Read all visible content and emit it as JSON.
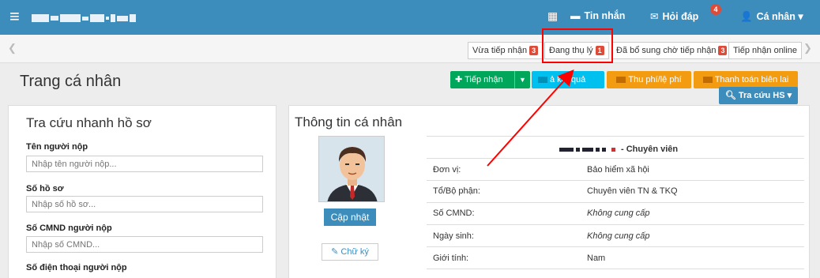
{
  "topbar": {
    "menu_icon": "hamburger-icon",
    "grid_icon": "grid-icon",
    "messages_label": "Tin nhắn",
    "qa_label": "Hỏi đáp",
    "qa_badge": "4",
    "personal_label": "Cá nhân",
    "personal_caret": "▾"
  },
  "tabs": [
    {
      "label": "Vừa tiếp nhận",
      "count": "3"
    },
    {
      "label": "Đang thụ lý",
      "count": "1"
    },
    {
      "label": "Đã bổ sung chờ tiếp nhận",
      "count": "3"
    },
    {
      "label": "Tiếp nhận online",
      "count": ""
    }
  ],
  "page": {
    "title": "Trang cá nhân"
  },
  "toolbar": {
    "receive_label": "Tiếp nhận",
    "result_label": "ả kết quả",
    "fee_label": "Thu phí/lệ phí",
    "payment_label": "Thanh toán biên lai",
    "search_label": "Tra cứu HS"
  },
  "search_panel": {
    "title": "Tra cứu nhanh hồ sơ",
    "fields": [
      {
        "label": "Tên người nộp",
        "placeholder": "Nhập tên người nộp..."
      },
      {
        "label": "Số hồ sơ",
        "placeholder": "Nhập số hồ sơ..."
      },
      {
        "label": "Số CMND người nộp",
        "placeholder": "Nhập số CMND..."
      },
      {
        "label": "Số điện thoại người nộp",
        "placeholder": ""
      }
    ]
  },
  "profile": {
    "title": "Thông tin cá nhân",
    "update_label": "Cập nhật",
    "signature_label": "Chữ ký",
    "name_suffix": "- Chuyên viên",
    "rows": [
      {
        "key": "Đơn vị:",
        "value": "Bảo hiểm xã hội",
        "italic": false
      },
      {
        "key": "Tổ/Bộ phận:",
        "value": "Chuyên viên TN & TKQ",
        "italic": false
      },
      {
        "key": "Số CMND:",
        "value": "Không cung cấp",
        "italic": true
      },
      {
        "key": "Ngày sinh:",
        "value": "Không cung cấp",
        "italic": true
      },
      {
        "key": "Giới tính:",
        "value": "Nam",
        "italic": false
      }
    ]
  },
  "colors": {
    "topbar": "#3c8dbc",
    "green": "#00a65a",
    "cyan": "#00c0ef",
    "orange": "#f39c12",
    "red_highlight": "#ff0000"
  }
}
